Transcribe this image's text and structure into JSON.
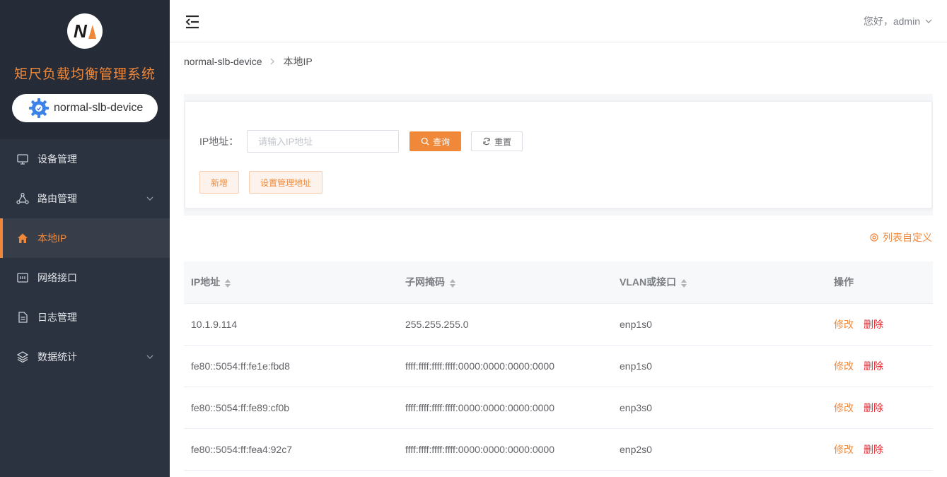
{
  "sidebar": {
    "system_title": "矩尺负载均衡管理系统",
    "device_name": "normal-slb-device",
    "menu": [
      {
        "label": "设备管理",
        "icon": "monitor-icon",
        "has_children": false,
        "active": false
      },
      {
        "label": "路由管理",
        "icon": "route-icon",
        "has_children": true,
        "active": false
      },
      {
        "label": "本地IP",
        "icon": "home-icon",
        "has_children": false,
        "active": true
      },
      {
        "label": "网络接口",
        "icon": "network-interface-icon",
        "has_children": false,
        "active": false
      },
      {
        "label": "日志管理",
        "icon": "document-icon",
        "has_children": false,
        "active": false
      },
      {
        "label": "数据统计",
        "icon": "layers-icon",
        "has_children": true,
        "active": false
      }
    ]
  },
  "header": {
    "greeting": "您好，admin"
  },
  "breadcrumb": {
    "items": [
      "normal-slb-device",
      "本地IP"
    ]
  },
  "search": {
    "ip_label": "IP地址：",
    "ip_placeholder": "请输入IP地址",
    "query_label": "查询",
    "reset_label": "重置",
    "add_label": "新增",
    "set_mgmt_label": "设置管理地址"
  },
  "table": {
    "customize_label": "列表自定义",
    "columns": [
      "IP地址",
      "子网掩码",
      "VLAN或接口",
      "操作"
    ],
    "edit_label": "修改",
    "delete_label": "删除",
    "rows": [
      {
        "ip": "10.1.9.114",
        "mask": "255.255.255.0",
        "iface": "enp1s0"
      },
      {
        "ip": "fe80::5054:ff:fe1e:fbd8",
        "mask": "ffff:ffff:ffff:ffff:0000:0000:0000:0000",
        "iface": "enp1s0"
      },
      {
        "ip": "fe80::5054:ff:fe89:cf0b",
        "mask": "ffff:ffff:ffff:ffff:0000:0000:0000:0000",
        "iface": "enp3s0"
      },
      {
        "ip": "fe80::5054:ff:fea4:92c7",
        "mask": "ffff:ffff:ffff:ffff:0000:0000:0000:0000",
        "iface": "enp2s0"
      }
    ]
  },
  "colors": {
    "accent": "#f0883a",
    "sidebar_bg": "#2b3240",
    "danger": "#e8272e"
  }
}
